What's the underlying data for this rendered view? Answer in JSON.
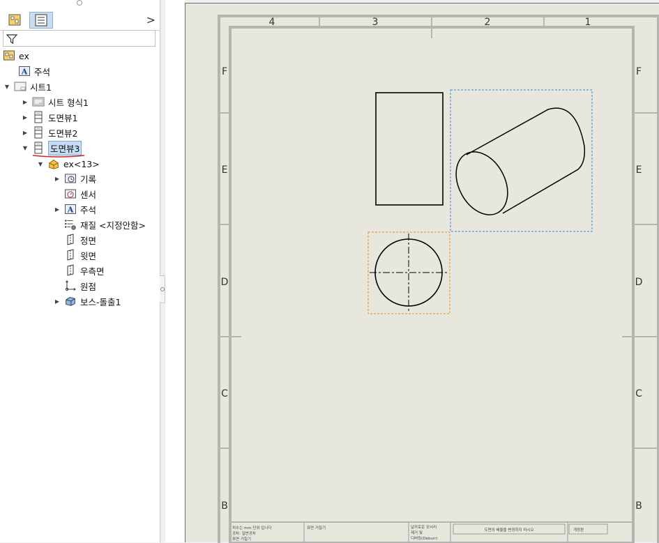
{
  "tree": {
    "panel_tabs": [
      {
        "name": "FeatureManager",
        "icon": "feature-manager-icon"
      },
      {
        "name": "PropertyManager",
        "icon": "property-manager-icon"
      }
    ],
    "tabs_more": ">",
    "filter_icon": "filter-icon",
    "items": [
      {
        "label": "ex",
        "icon": "drawing-icon",
        "expander": ""
      },
      {
        "label": "주석",
        "icon": "annotation-folder-icon",
        "expander": ""
      },
      {
        "label": "시트1",
        "icon": "sheet-icon",
        "expander": "expanded"
      },
      {
        "label": "시트 형식1",
        "icon": "sheet-format-icon",
        "expander": "collapsed"
      },
      {
        "label": "도면뷰1",
        "icon": "drawing-view-icon",
        "expander": "collapsed"
      },
      {
        "label": "도면뷰2",
        "icon": "drawing-view-icon",
        "expander": "collapsed"
      },
      {
        "label": "도면뷰3",
        "icon": "drawing-view-icon",
        "expander": "expanded",
        "selected": true
      },
      {
        "label": "ex<13>",
        "icon": "part-icon",
        "expander": "expanded"
      },
      {
        "label": "기록",
        "icon": "history-folder-icon",
        "expander": "collapsed"
      },
      {
        "label": "센서",
        "icon": "sensor-folder-icon",
        "expander": ""
      },
      {
        "label": "주석",
        "icon": "annotation-folder-icon",
        "expander": "collapsed"
      },
      {
        "label": "재질 <지정안함>",
        "icon": "material-icon",
        "expander": ""
      },
      {
        "label": "정면",
        "icon": "plane-icon",
        "expander": ""
      },
      {
        "label": "윗면",
        "icon": "plane-icon",
        "expander": ""
      },
      {
        "label": "우측면",
        "icon": "plane-icon",
        "expander": ""
      },
      {
        "label": "원점",
        "icon": "origin-icon",
        "expander": ""
      },
      {
        "label": "보스-돌출1",
        "icon": "boss-extrude-icon",
        "expander": "collapsed"
      }
    ]
  },
  "sheet": {
    "column_labels": [
      "4",
      "3",
      "2",
      "1"
    ],
    "row_labels": [
      "F",
      "E",
      "D",
      "C",
      "B"
    ],
    "view_frame_colors": {
      "isometric": "#3a86d8",
      "front": "#f08a1c"
    }
  },
  "title_block": {
    "cell1": [
      "치수는 mm 단위 입니다",
      "공차: 일반공차",
      "표면 거칠기"
    ],
    "cell2": "표면 거칠기",
    "cell3": [
      "날카로운 모서리",
      "제거 및",
      "디버링(Deburr)"
    ],
    "cell4": "도면의 배율을 변경하지 마시오",
    "cell5": "개정판"
  }
}
